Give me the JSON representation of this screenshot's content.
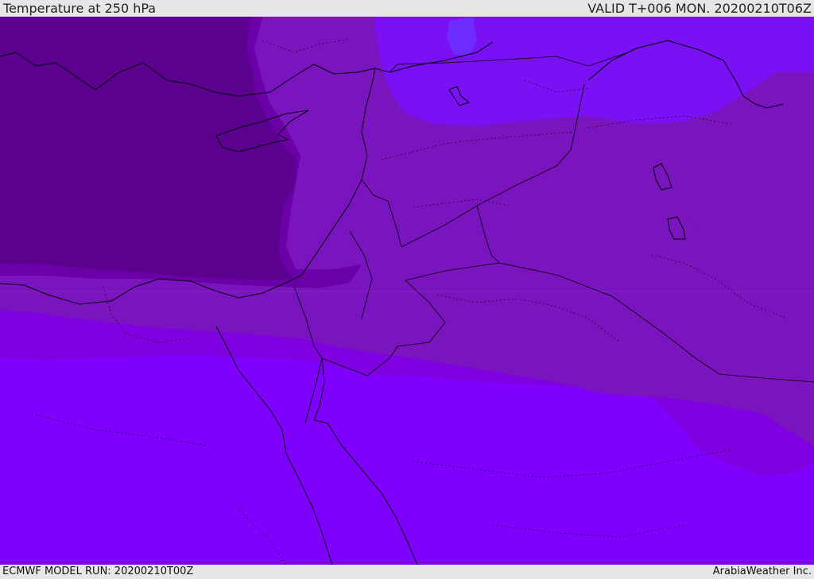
{
  "header": {
    "title": "Temperature at 250 hPa",
    "valid_time": "VALID T+006 MON. 20200210T06Z"
  },
  "footer": {
    "model_run": "ECMWF MODEL RUN: 20200210T00Z",
    "credit": "ArabiaWeather Inc."
  },
  "map": {
    "parameter": "temperature",
    "pressure_level_hpa": 250,
    "colors": {
      "band_coldest": "#5c0090",
      "band_cold": "#6c00a8",
      "band_mid": "#7a14bf",
      "band_mild": "#7f00e0",
      "band_warm": "#7f00ff",
      "band_north_warm": "#7a10f4",
      "band_pocket": "#6c2cff",
      "coastline": "#000000"
    },
    "layers": [
      "temperature-shading",
      "coastlines",
      "country-borders",
      "admin-borders"
    ]
  }
}
